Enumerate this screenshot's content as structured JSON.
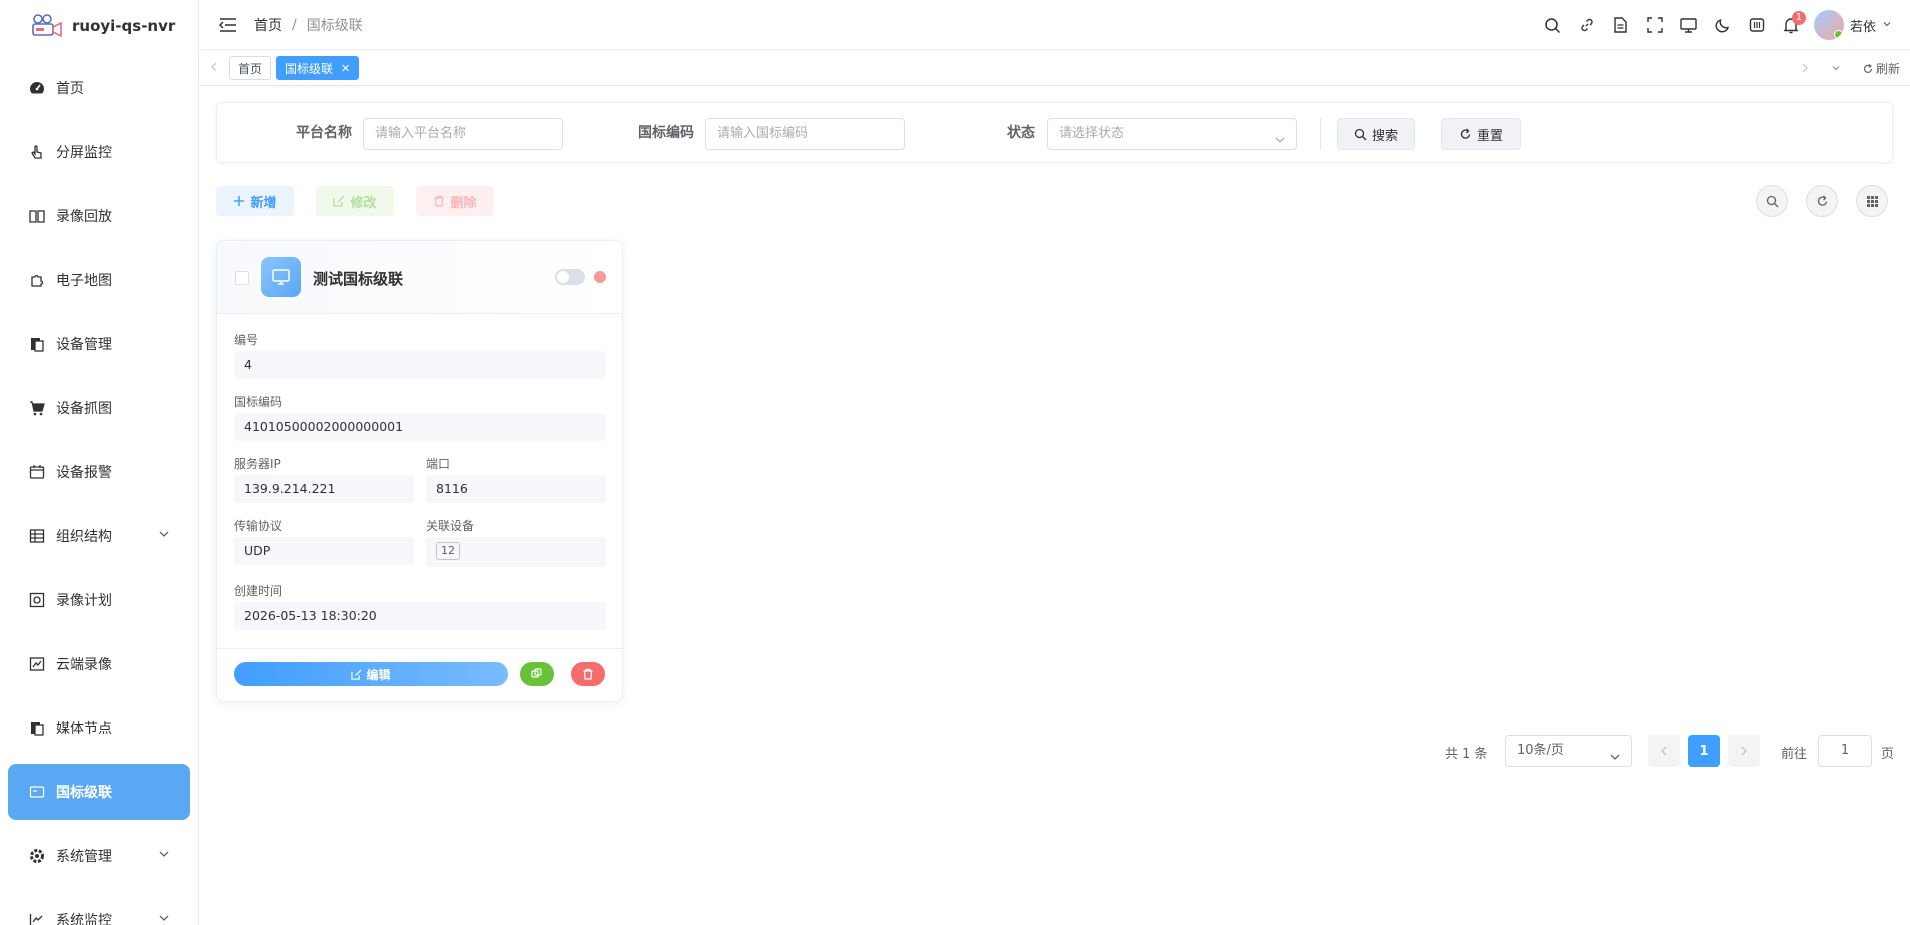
{
  "app": {
    "title": "ruoyi-qs-nvr"
  },
  "sidebar": {
    "items": [
      {
        "label": "首页",
        "icon": "dashboard-icon",
        "active": false
      },
      {
        "label": "分屏监控",
        "icon": "hand-pointer-icon",
        "active": false
      },
      {
        "label": "录像回放",
        "icon": "book-icon",
        "active": false
      },
      {
        "label": "电子地图",
        "icon": "puzzle-icon",
        "active": false
      },
      {
        "label": "设备管理",
        "icon": "clipboard-icon",
        "active": false
      },
      {
        "label": "设备抓图",
        "icon": "cart-icon",
        "active": false
      },
      {
        "label": "设备报警",
        "icon": "calendar-icon",
        "active": false
      },
      {
        "label": "组织结构",
        "icon": "table-icon",
        "active": false
      },
      {
        "label": "录像计划",
        "icon": "gear-box-icon",
        "active": false
      },
      {
        "label": "云端录像",
        "icon": "chart-box-icon",
        "active": false
      },
      {
        "label": "媒体节点",
        "icon": "clipboard-icon",
        "active": false
      },
      {
        "label": "国标级联",
        "icon": "id-card-icon",
        "active": true
      },
      {
        "label": "系统管理",
        "icon": "gear-icon",
        "active": false
      },
      {
        "label": "系统监控",
        "icon": "monitor-chart-icon",
        "active": false
      }
    ]
  },
  "navbar": {
    "breadcrumb_home": "首页",
    "breadcrumb_sep": "/",
    "breadcrumb_current": "国标级联",
    "notification_count": "1",
    "user_name": "若依"
  },
  "tags": {
    "home": "首页",
    "current": "国标级联",
    "close": "✕",
    "refresh": "刷新"
  },
  "search": {
    "platform_label": "平台名称",
    "platform_placeholder": "请输入平台名称",
    "code_label": "国标编码",
    "code_placeholder": "请输入国标编码",
    "status_label": "状态",
    "status_placeholder": "请选择状态",
    "search_btn": "搜索",
    "reset_btn": "重置"
  },
  "toolbar": {
    "add": "新增",
    "edit": "修改",
    "delete": "删除"
  },
  "card": {
    "title": "测试国标级联",
    "id_label": "编号",
    "id_value": "4",
    "code_label": "国标编码",
    "code_value": "41010500002000000001",
    "ip_label": "服务器IP",
    "ip_value": "139.9.214.221",
    "port_label": "端口",
    "port_value": "8116",
    "protocol_label": "传输协议",
    "protocol_value": "UDP",
    "devices_label": "关联设备",
    "devices_value": "12",
    "created_label": "创建时间",
    "created_value": "2026-05-13 18:30:20",
    "edit_btn": "编辑",
    "enabled": false
  },
  "pagination": {
    "total": "共 1 条",
    "page_size": "10条/页",
    "current": "1",
    "goto_label": "前往",
    "goto_value": "1",
    "page_suffix": "页"
  },
  "colors": {
    "primary": "#409eff",
    "sidebar_active": "#5aa7f3",
    "success": "#67c23a",
    "danger": "#f56c6c"
  }
}
